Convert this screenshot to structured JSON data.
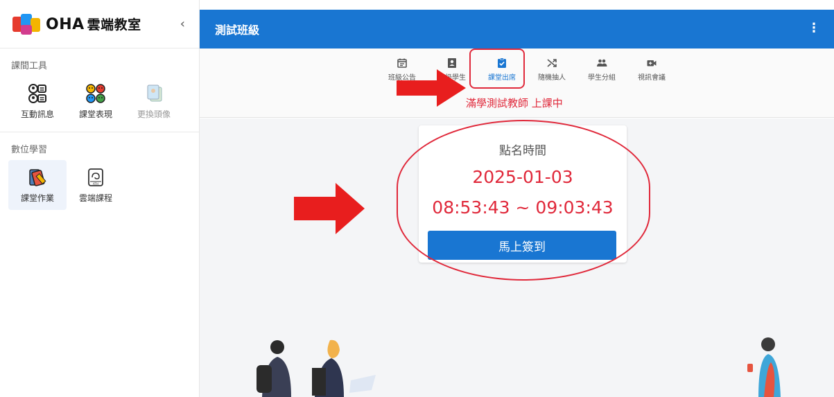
{
  "sidebar": {
    "brand_oha": "OHA",
    "brand_name": "雲端教室",
    "collapse_icon": "‹",
    "sections": [
      {
        "title": "課間工具",
        "items": [
          {
            "label": "互動訊息",
            "icon": "chat-avatars-icon"
          },
          {
            "label": "課堂表現",
            "icon": "emoji-faces-icon"
          },
          {
            "label": "更換頭像",
            "icon": "avatar-cards-icon",
            "disabled": true
          }
        ]
      },
      {
        "title": "數位學習",
        "items": [
          {
            "label": "課堂作業",
            "icon": "homework-books-icon",
            "active": true
          },
          {
            "label": "雲端課程",
            "icon": "cloud-course-icon"
          }
        ]
      }
    ]
  },
  "header": {
    "title": "測試班級",
    "menu_icon": "⋮"
  },
  "tabs": [
    {
      "label": "班級公告",
      "icon": "calendar-icon"
    },
    {
      "label": "班級學生",
      "icon": "contact-card-icon"
    },
    {
      "label": "課堂出席",
      "icon": "clipboard-check-icon",
      "active": true
    },
    {
      "label": "隨機抽人",
      "icon": "shuffle-icon"
    },
    {
      "label": "學生分組",
      "icon": "group-icon"
    },
    {
      "label": "視訊會議",
      "icon": "video-call-icon"
    }
  ],
  "status_text": "滿學測試教師 上課中",
  "attendance": {
    "caption": "點名時間",
    "date": "2025-01-03",
    "time_range": "08:53:43 ~ 09:03:43",
    "button_label": "馬上簽到"
  },
  "colors": {
    "primary": "#1976d2",
    "accent_red": "#e0283a",
    "background": "#f4f5f7"
  }
}
